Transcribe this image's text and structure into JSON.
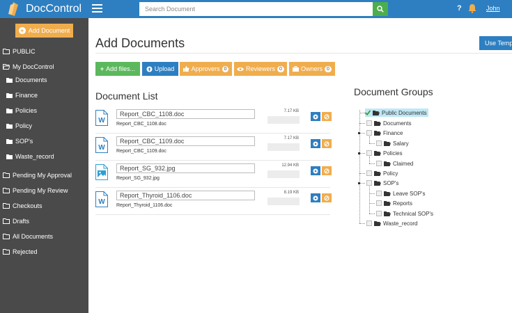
{
  "app": {
    "brand": "DocControl",
    "user": "John",
    "help": "?"
  },
  "search": {
    "placeholder": "Search Document"
  },
  "sidebar": {
    "add_label": "Add Document",
    "items": [
      {
        "label": "PUBLIC"
      },
      {
        "label": "My DocControl"
      },
      {
        "label": "Documents"
      },
      {
        "label": "Finance"
      },
      {
        "label": "Policies"
      },
      {
        "label": "Policy"
      },
      {
        "label": "SOP's"
      },
      {
        "label": "Waste_record"
      },
      {
        "label": "Pending My Approval"
      },
      {
        "label": "Pending My Review"
      },
      {
        "label": "Checkouts"
      },
      {
        "label": "Drafts"
      },
      {
        "label": "All Documents"
      },
      {
        "label": "Rejected"
      }
    ]
  },
  "main": {
    "title": "Add Documents",
    "use_template_label": "Use Temp",
    "toolbar": {
      "add_files": "Add files...",
      "upload": "Upload",
      "approvers": "Approvers",
      "approvers_count": "0",
      "reviewers": "Reviewers",
      "reviewers_count": "0",
      "owners": "Owners",
      "owners_count": "0"
    },
    "list_title": "Document List",
    "documents": [
      {
        "name": "Report_CBC_1108.doc",
        "file": "Report_CBC_1108.doc",
        "size": "7.17 KB",
        "type": "word"
      },
      {
        "name": "Report_CBC_1109.doc",
        "file": "Report_CBC_1109.doc",
        "size": "7.17 KB",
        "type": "word"
      },
      {
        "name": "Report_SG_932.jpg",
        "file": "Report_SG_932.jpg",
        "size": "12.94 KB",
        "type": "image"
      },
      {
        "name": "Report_Thyroid_1106.doc",
        "file": "Report_Thyroid_1106.doc",
        "size": "8.19 KB",
        "type": "word"
      }
    ],
    "groups_title": "Document Groups",
    "groups": [
      {
        "label": "Public Documents",
        "checked": true,
        "selected": true
      },
      {
        "label": "Documents"
      },
      {
        "label": "Finance"
      },
      {
        "label": "Salary"
      },
      {
        "label": "Policies"
      },
      {
        "label": "Claimed"
      },
      {
        "label": "Policy"
      },
      {
        "label": "SOP's"
      },
      {
        "label": "Leave SOP's"
      },
      {
        "label": "Reports"
      },
      {
        "label": "Technical SOP's"
      },
      {
        "label": "Waste_record"
      }
    ]
  },
  "colors": {
    "topbar": "#2d7fc1",
    "sidebar": "#4a4a4a",
    "green": "#5cb85c",
    "orange": "#f0ad4e",
    "selected": "#bfe7f5"
  }
}
